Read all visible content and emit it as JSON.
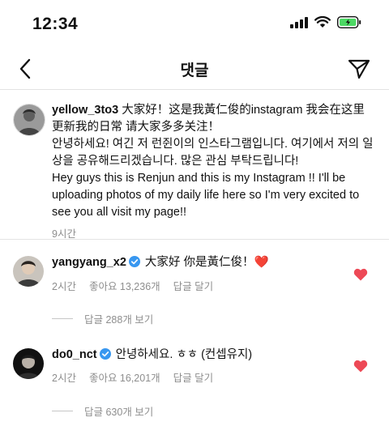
{
  "status": {
    "time": "12:34"
  },
  "nav": {
    "title": "댓글"
  },
  "caption": {
    "username": "yellow_3to3",
    "text_zh": "大家好！这是我黃仁俊的instagram 我会在这里更新我的日常 请大家多多关注！",
    "text_ko": "안녕하세요! 여긴 저 런쥔이의 인스타그램입니다. 여기에서 저의 일상을 공유해드리겠습니다. 많은 관심 부탁드립니다!",
    "text_en": "Hey guys this is Renjun and this is my Instagram !! I'll be uploading photos of my daily life here so I'm very excited to see you all visit my page!!",
    "time": "9시간"
  },
  "comments": [
    {
      "username": "yangyang_x2",
      "text": "大家好 你是黃仁俊！❤️",
      "time": "2시간",
      "likes": "좋아요 13,236개",
      "reply": "답글 달기",
      "view_replies": "답글 288개 보기",
      "liked": true
    },
    {
      "username": "do0_nct",
      "text": "안녕하세요. ㅎㅎ (컨셉유지)",
      "time": "2시간",
      "likes": "좋아요 16,201개",
      "reply": "답글 달기",
      "view_replies": "답글 630개 보기",
      "liked": true
    }
  ],
  "colors": {
    "verified": "#3897f0",
    "heart": "#ed4956",
    "battery": "#4cd964"
  }
}
